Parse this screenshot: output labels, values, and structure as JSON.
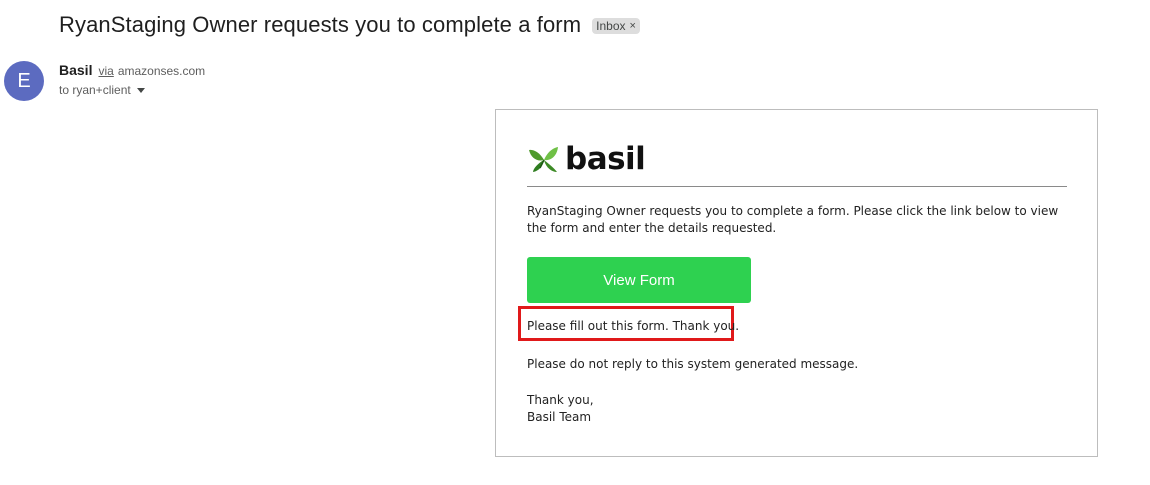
{
  "email": {
    "subject": "RyanStaging Owner requests you to complete a form",
    "label": "Inbox",
    "label_close": "×",
    "avatar_letter": "E",
    "sender_name": "Basil",
    "via_text": "via",
    "via_domain": "amazonses.com",
    "to_text": "to ryan+client"
  },
  "body": {
    "logo_text": "basil",
    "intro": "RyanStaging Owner requests you to complete a form. Please click the link below to view the form and enter the details requested.",
    "button_label": "View Form",
    "note": "Please fill out this form. Thank you.",
    "noreply": "Please do not reply to this system generated message.",
    "signoff_line1": "Thank you,",
    "signoff_line2": "Basil Team"
  },
  "colors": {
    "button": "#2ed150",
    "highlight": "#e0191a",
    "avatar": "#5c6bc0"
  }
}
